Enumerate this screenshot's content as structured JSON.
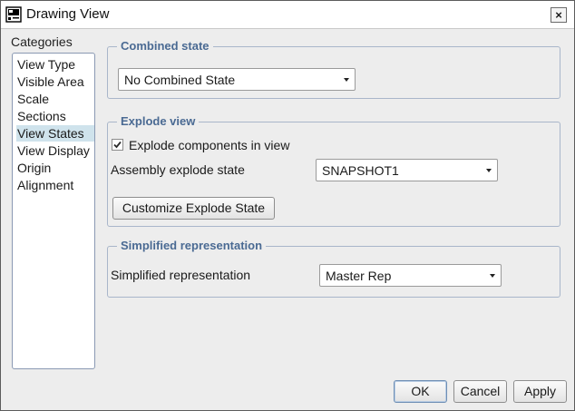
{
  "window": {
    "title": "Drawing View",
    "close_glyph": "×"
  },
  "categories": {
    "label": "Categories",
    "items": [
      {
        "label": "View Type"
      },
      {
        "label": "Visible Area"
      },
      {
        "label": "Scale"
      },
      {
        "label": "Sections"
      },
      {
        "label": "View States",
        "selected": true
      },
      {
        "label": "View Display"
      },
      {
        "label": "Origin"
      },
      {
        "label": "Alignment"
      }
    ],
    "selected_color": "#cfe3ec"
  },
  "combined_state": {
    "title": "Combined state",
    "select_value": "No Combined State"
  },
  "explode_view": {
    "title": "Explode view",
    "checkbox_label": "Explode components in view",
    "checkbox_checked": true,
    "state_label": "Assembly explode state",
    "state_value": "SNAPSHOT1",
    "customize_button": "Customize Explode State"
  },
  "simplified": {
    "title": "Simplified representation",
    "label": "Simplified representation",
    "value": "Master Rep"
  },
  "footer": {
    "ok": "OK",
    "cancel": "Cancel",
    "apply": "Apply"
  },
  "icons": {
    "app": "drawing-view-icon",
    "close": "close-icon",
    "dropdown": "chevron-down-icon",
    "check": "check-icon"
  },
  "colors": {
    "group_title": "#4a6a93",
    "group_border": "#a9b6ca",
    "default_button_border": "#6f8fb5"
  }
}
